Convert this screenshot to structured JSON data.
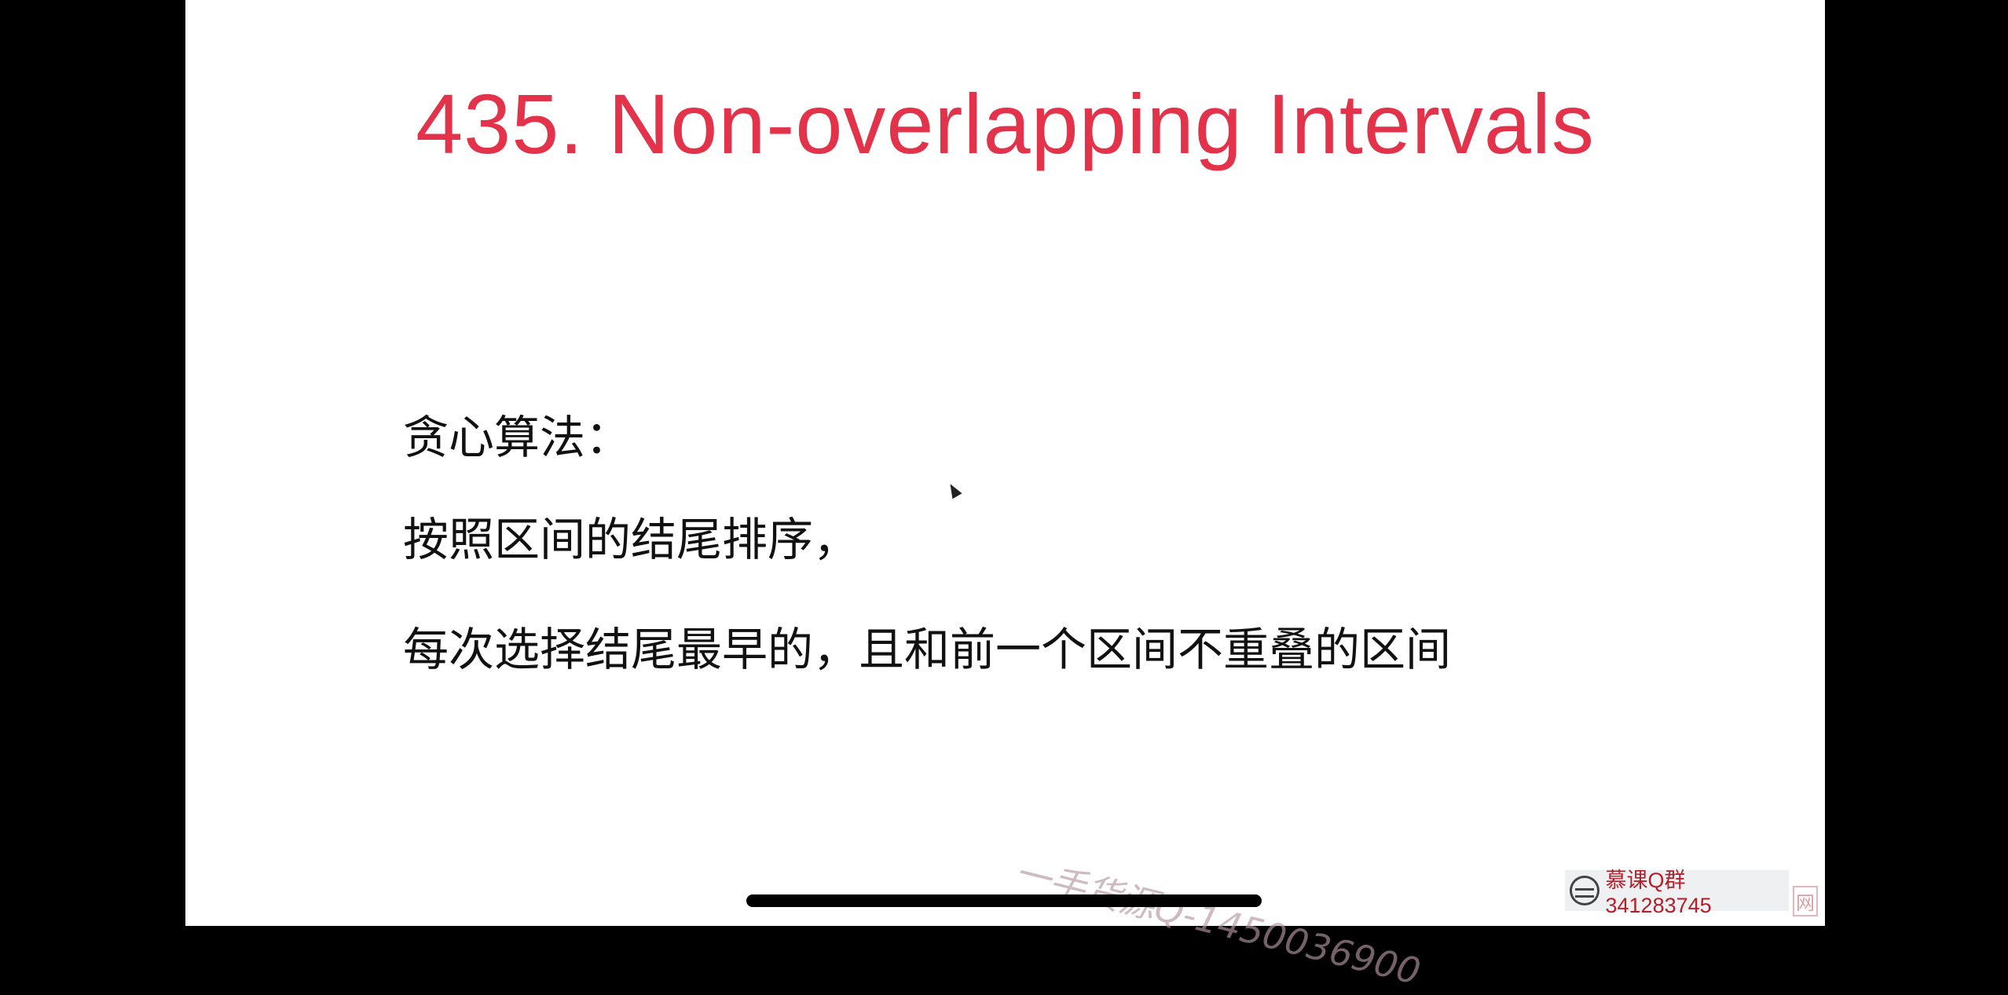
{
  "slide": {
    "title": "435. Non-overlapping Intervals",
    "title_color": "#e2334b",
    "lines": [
      "贪心算法：",
      "按照区间的结尾排序，",
      "每次选择结尾最早的，且和前一个区间不重叠的区间"
    ]
  },
  "watermarks": {
    "diagonal": "一手货源Q-1450036900",
    "badge": "慕课Q群341283745",
    "badge_suffix": "网"
  }
}
